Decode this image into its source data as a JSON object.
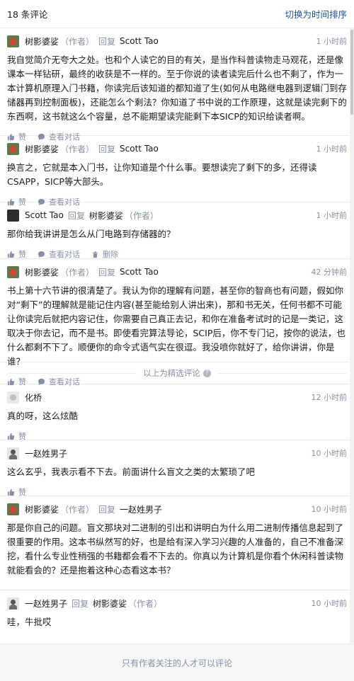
{
  "header": {
    "count_label": "18 条评论",
    "switch_label": "切换为时间排序"
  },
  "actions": {
    "like": "赞",
    "view_dialog": "查看对话",
    "delete": "删除"
  },
  "reply_word": "回复",
  "author_tag": "（作者）",
  "featured_divider": "以上为精选评论",
  "comments": [
    {
      "author": "树影婆娑",
      "author_is_op": true,
      "reply_to": "Scott Tao",
      "time": "1 小时前",
      "text": "我自觉简介无夸大之处。也和个人读它的目的有关，是当作科普读物走马观花，还是像课本一样钻研，最终的收获是不一样的。至于你说的读者读完后什么也不剩了，作为一本计算机原理入门书籍，你读完后该知道的都知道了生(如何从电路继电器到逻辑门到存储器再到控制面板)，还能怎么个剩法？你知道了书中说的工作原理，这就是读完剩下的东西啊，这书就这么个容量，总不能期望读完能剩下本SICP的知识给读者啊。"
    },
    {
      "author": "树影婆娑",
      "author_is_op": true,
      "reply_to": "Scott Tao",
      "time": "1 小时前",
      "text": "换言之，它就是本入门书，让你知道是个什么事。要想读完了剩下的多，还得读CSAPP，SICP等大部头。"
    },
    {
      "author": "Scott Tao",
      "reply_to": "树影婆娑",
      "reply_to_is_op": true,
      "time": "1 小时前",
      "text": "那你给我讲讲是怎么从门电路到存储器的？"
    },
    {
      "author": "树影婆娑",
      "author_is_op": true,
      "reply_to": "Scott Tao",
      "time": "42 分钟前",
      "text": "书上第十六节讲的很清楚了。我认为你的理解有问题，甚至你的智商也有问题，假如你对“剩下”的理解就是能记住内容(甚至能给别人讲出来)，那和书无关，任何书都不可能让你读完后就把内容记住，你需要自己真正去记，和你在准备考试时的记是一类记，这取决于你去记，而不是书。即使看完算法导论，SCIP后，你不专门记，按你的说法，也什么都剩不下了。顺便你的命令式语气实在很逗。我没喷你就好了，给你讲讲，你是谁？"
    },
    {
      "author": "化桥",
      "time": "12 小时前",
      "text": "真的呀，这么炫酷"
    },
    {
      "author": "一赵姓男子",
      "time": "10 小时前",
      "text": "这么玄乎，我表示看不下去。前面讲什么盲文之类的太繁琐了吧"
    },
    {
      "author": "树影婆娑",
      "author_is_op": true,
      "reply_to": "一赵姓男子",
      "time": "10 小时前",
      "text": "那是你自己的问题。盲文那块对二进制的引出和讲明白为什么用二进制传播信息起到了很重要的作用。这本书纵然写的好，也是给有深入学习兴趣的人准备的，自己不准备深挖，看什么专业性稍强的书籍都会看不下去的。你真以为计算机是你看个休闲科普读物就能看会的？还是抱着这种心态看这本书？"
    },
    {
      "author": "一赵姓男子",
      "reply_to": "树影婆娑",
      "reply_to_is_op": true,
      "time": "10 小时前",
      "text": "哇，牛批哎"
    }
  ],
  "footer_note": "只有作者关注的人才可以评论",
  "colors": {
    "link": "#175199",
    "meta": "#8590a6",
    "border": "#ebebeb"
  }
}
